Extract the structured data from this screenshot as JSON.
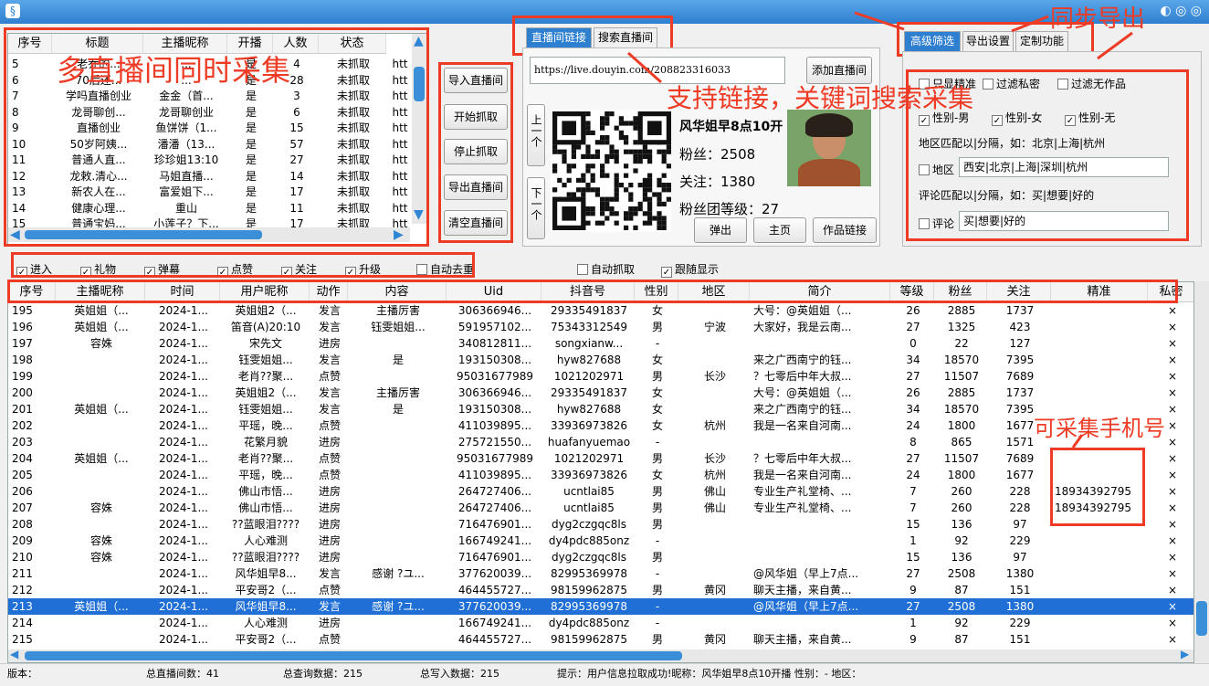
{
  "window": {
    "icon": "app-icon"
  },
  "top_table": {
    "headers": [
      "序号",
      "标题",
      "主播昵称",
      "开播",
      "人数",
      "状态"
    ],
    "rows": [
      [
        "5",
        "老乔的...",
        "...",
        "是",
        "4",
        "未抓取",
        "htt"
      ],
      [
        "6",
        "70后还...",
        "...",
        "是",
        "28",
        "未抓取",
        "htt"
      ],
      [
        "7",
        "学吗直播创业",
        "金金（首...",
        "是",
        "3",
        "未抓取",
        "htt"
      ],
      [
        "8",
        "龙哥聊创...",
        "龙哥聊创业",
        "是",
        "6",
        "未抓取",
        "htt"
      ],
      [
        "9",
        "直播创业",
        "鱼饼饼（1...",
        "是",
        "15",
        "未抓取",
        "htt"
      ],
      [
        "10",
        "50岁阿姨...",
        "潘潘（13...",
        "是",
        "57",
        "未抓取",
        "htt"
      ],
      [
        "11",
        "普通人直...",
        "珍珍姐13:10",
        "是",
        "27",
        "未抓取",
        "htt"
      ],
      [
        "12",
        "龙敕.清心...",
        "马姐直播...",
        "是",
        "14",
        "未抓取",
        "htt"
      ],
      [
        "13",
        "新农人在...",
        "富爱姐下...",
        "是",
        "17",
        "未抓取",
        "htt"
      ],
      [
        "14",
        "健康心理...",
        "重山",
        "是",
        "11",
        "未抓取",
        "htt"
      ],
      [
        "15",
        "普通宝妈...",
        "小莲子？下...",
        "是",
        "17",
        "未抓取",
        "htt"
      ]
    ]
  },
  "buttons": {
    "import": "导入直播间",
    "start": "开始抓取",
    "stop": "停止抓取",
    "export": "导出直播间",
    "clear": "清空直播间",
    "add": "添加直播间",
    "prev": "上一个",
    "next": "下一个",
    "popup": "弹出",
    "home": "主页",
    "works": "作品链接"
  },
  "tabs": {
    "link": "直播间链接",
    "search": "搜索直播间",
    "adv": "高级筛选",
    "export": "导出设置",
    "custom": "定制功能"
  },
  "link_input": "https://live.douyin.com/208823316033",
  "profile": {
    "name": "风华姐早8点10开",
    "fans_label": "粉丝：",
    "fans": "2508",
    "follow_label": "关注：",
    "follow": "1380",
    "fanclub_label": "粉丝团等级：",
    "fanclub": "27"
  },
  "filter": {
    "only_precise": "只显精准",
    "filter_private": "过滤私密",
    "filter_noworks": "过滤无作品",
    "male": "性别-男",
    "female": "性别-女",
    "none": "性别-无",
    "region_hint": "地区匹配以|分隔，如：北京|上海|杭州",
    "region_label": "地区",
    "region_value": "西安|北京|上海|深圳|杭州",
    "comment_hint": "评论匹配以|分隔，如：买|想要|好的",
    "comment_label": "评论",
    "comment_value": "买|想要|好的"
  },
  "checks": {
    "enter": "进入",
    "gift": "礼物",
    "danmu": "弹幕",
    "like": "点赞",
    "follow": "关注",
    "upgrade": "升级",
    "dedup": "自动去重",
    "auto": "自动抓取",
    "follow_show": "跟随显示"
  },
  "annotations": {
    "multi": "多直播间同时采集",
    "sync": "同步导出",
    "support": "支持链接，关键词搜索采集",
    "phone": "可采集手机号"
  },
  "main_table": {
    "headers": [
      "序号",
      "主播昵称",
      "时间",
      "用户昵称",
      "动作",
      "内容",
      "Uid",
      "抖音号",
      "性别",
      "地区",
      "简介",
      "等级",
      "粉丝",
      "关注",
      "精准",
      "私密"
    ],
    "rows": [
      [
        "195",
        "英姐姐（...",
        "2024-1...",
        "英姐姐2（...",
        "发言",
        "主播厉害",
        "306366946...",
        "29335491837",
        "女",
        "",
        "大号：@英姐姐（...",
        "26",
        "2885",
        "1737",
        "",
        "×"
      ],
      [
        "196",
        "英姐姐（...",
        "2024-1...",
        "笛音(A)20:10",
        "发言",
        "钰雯姐姐...",
        "591957102...",
        "75343312549",
        "男",
        "宁波",
        "大家好，我是云南...",
        "27",
        "1325",
        "423",
        "",
        "×"
      ],
      [
        "197",
        "容姝",
        "2024-1...",
        "宋先文",
        "进房",
        "",
        "340812811...",
        "songxianw...",
        "-",
        "",
        "",
        "0",
        "22",
        "127",
        "",
        "×"
      ],
      [
        "198",
        "",
        "2024-1...",
        "钰雯姐姐...",
        "发言",
        "是",
        "193150308...",
        "hyw827688",
        "女",
        "",
        "来之广西南宁的钰...",
        "34",
        "18570",
        "7395",
        "",
        "×"
      ],
      [
        "199",
        "",
        "2024-1...",
        "老肖??聚...",
        "点赞",
        "",
        "95031677989",
        "1021202971",
        "男",
        "长沙",
        "？七零后中年大叔...",
        "27",
        "11507",
        "7689",
        "",
        "×"
      ],
      [
        "200",
        "",
        "2024-1...",
        "英姐姐2（...",
        "发言",
        "主播厉害",
        "306366946...",
        "29335491837",
        "女",
        "",
        "大号：@英姐姐（...",
        "26",
        "2885",
        "1737",
        "",
        "×"
      ],
      [
        "201",
        "英姐姐（...",
        "2024-1...",
        "钰雯姐姐...",
        "发言",
        "是",
        "193150308...",
        "hyw827688",
        "女",
        "",
        "来之广西南宁的钰...",
        "34",
        "18570",
        "7395",
        "",
        "×"
      ],
      [
        "202",
        "",
        "2024-1...",
        "平瑶，晚...",
        "点赞",
        "",
        "411039895...",
        "33936973826",
        "女",
        "杭州",
        "我是一名来自河南...",
        "24",
        "1800",
        "1677",
        "",
        "×"
      ],
      [
        "203",
        "",
        "2024-1...",
        "花繁月貌",
        "进房",
        "",
        "275721550...",
        "huafanyuemao",
        "-",
        "",
        "",
        "8",
        "865",
        "1571",
        "",
        "×"
      ],
      [
        "204",
        "英姐姐（...",
        "2024-1...",
        "老肖??聚...",
        "点赞",
        "",
        "95031677989",
        "1021202971",
        "男",
        "长沙",
        "？七零后中年大叔...",
        "27",
        "11507",
        "7689",
        "",
        "×"
      ],
      [
        "205",
        "",
        "2024-1...",
        "平瑶，晚...",
        "点赞",
        "",
        "411039895...",
        "33936973826",
        "女",
        "杭州",
        "我是一名来自河南...",
        "24",
        "1800",
        "1677",
        "",
        "×"
      ],
      [
        "206",
        "",
        "2024-1...",
        "佛山市悟...",
        "进房",
        "",
        "264727406...",
        "ucntlai85",
        "男",
        "佛山",
        "专业生产礼堂椅、...",
        "7",
        "260",
        "228",
        "18934392795",
        "×"
      ],
      [
        "207",
        "容姝",
        "2024-1...",
        "佛山市悟...",
        "进房",
        "",
        "264727406...",
        "ucntlai85",
        "男",
        "佛山",
        "专业生产礼堂椅、...",
        "7",
        "260",
        "228",
        "18934392795",
        "×"
      ],
      [
        "208",
        "",
        "2024-1...",
        "??蓝眼泪????",
        "进房",
        "",
        "716476901...",
        "dyg2czgqc8ls",
        "男",
        "",
        "",
        "15",
        "136",
        "97",
        "",
        "×"
      ],
      [
        "209",
        "容姝",
        "2024-1...",
        "人心难测",
        "进房",
        "",
        "166749241...",
        "dy4pdc885onz",
        "-",
        "",
        "",
        "1",
        "92",
        "229",
        "",
        "×"
      ],
      [
        "210",
        "容姝",
        "2024-1...",
        "??蓝眼泪????",
        "进房",
        "",
        "716476901...",
        "dyg2czgqc8ls",
        "男",
        "",
        "",
        "15",
        "136",
        "97",
        "",
        "×"
      ],
      [
        "211",
        "",
        "2024-1...",
        "风华姐早8...",
        "发言",
        "感谢 ?ユ...",
        "377620039...",
        "82995369978",
        "-",
        "",
        "@风华姐（早上7点...",
        "27",
        "2508",
        "1380",
        "",
        "×"
      ],
      [
        "212",
        "",
        "2024-1...",
        "平安哥2（...",
        "点赞",
        "",
        "464455727...",
        "98159962875",
        "男",
        "黄冈",
        "聊天主播，来自黄...",
        "9",
        "87",
        "151",
        "",
        "×"
      ],
      [
        "213",
        "英姐姐（...",
        "2024-1...",
        "风华姐早8...",
        "发言",
        "感谢 ?ユ...",
        "377620039...",
        "82995369978",
        "-",
        "",
        "@风华姐（早上7点...",
        "27",
        "2508",
        "1380",
        "",
        "×"
      ],
      [
        "214",
        "",
        "2024-1...",
        "人心难测",
        "进房",
        "",
        "166749241...",
        "dy4pdc885onz",
        "-",
        "",
        "",
        "1",
        "92",
        "229",
        "",
        "×"
      ],
      [
        "215",
        "",
        "2024-1...",
        "平安哥2（...",
        "点赞",
        "",
        "464455727...",
        "98159962875",
        "男",
        "黄冈",
        "聊天主播，来自黄...",
        "9",
        "87",
        "151",
        "",
        "×"
      ]
    ],
    "selected_index": 18
  },
  "status": {
    "version": "版本：",
    "total_rooms": "总直播间数：41",
    "total_query": "总查询数据：215",
    "total_write": "总写入数据：215",
    "tip": "提示：用户信息拉取成功!昵称：风华姐早8点10开播 性别：- 地区："
  },
  "colors": {
    "accent": "#2e7fd0",
    "annotation": "#ee3b26",
    "selected_row": "#1f6fd6"
  }
}
